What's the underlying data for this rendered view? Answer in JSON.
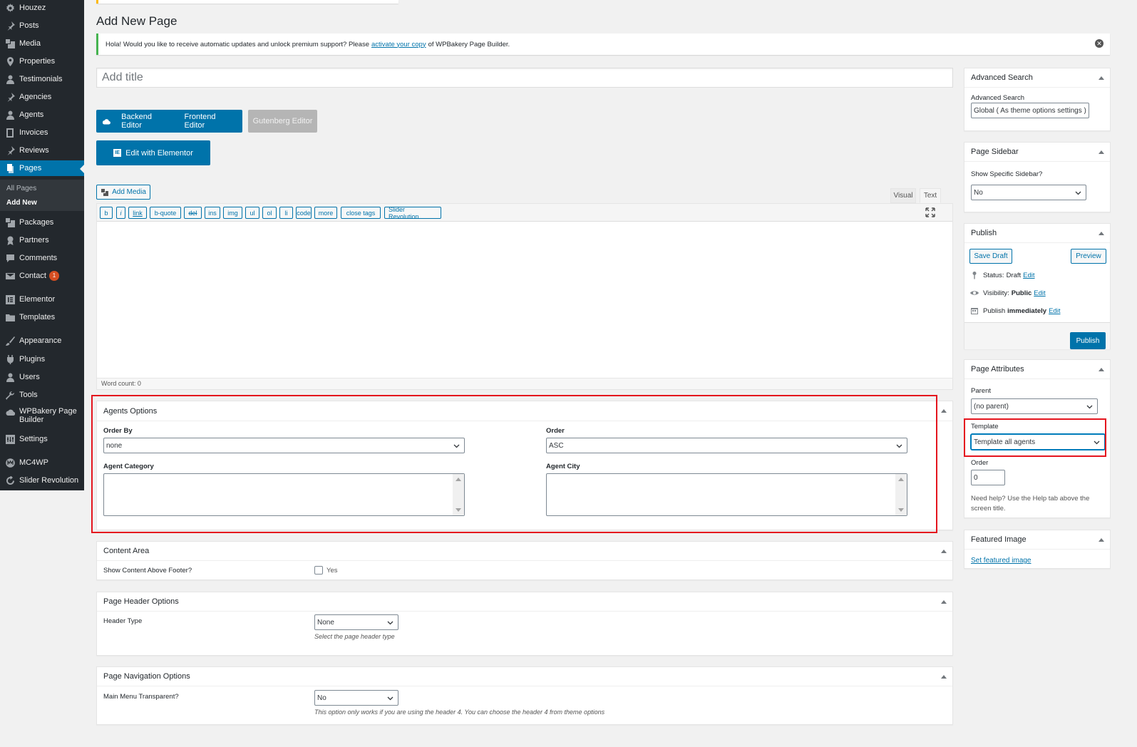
{
  "sidebar": {
    "items": [
      {
        "label": "Houzez",
        "icon": "gear-icon"
      },
      {
        "label": "Posts",
        "icon": "pin-icon"
      },
      {
        "label": "Media",
        "icon": "media-icon"
      },
      {
        "label": "Properties",
        "icon": "location-icon"
      },
      {
        "label": "Testimonials",
        "icon": "user-icon"
      },
      {
        "label": "Agencies",
        "icon": "pin-icon"
      },
      {
        "label": "Agents",
        "icon": "user-icon"
      },
      {
        "label": "Invoices",
        "icon": "book-icon"
      },
      {
        "label": "Reviews",
        "icon": "pin-icon"
      },
      {
        "label": "Pages",
        "icon": "pages-icon"
      },
      {
        "label": "Packages",
        "icon": "media-icon"
      },
      {
        "label": "Partners",
        "icon": "award-icon"
      },
      {
        "label": "Comments",
        "icon": "comment-icon"
      },
      {
        "label": "Contact",
        "icon": "mail-icon",
        "badge": "1"
      },
      {
        "label": "Elementor",
        "icon": "elementor-icon"
      },
      {
        "label": "Templates",
        "icon": "folder-icon"
      },
      {
        "label": "Appearance",
        "icon": "brush-icon"
      },
      {
        "label": "Plugins",
        "icon": "plugin-icon"
      },
      {
        "label": "Users",
        "icon": "user-icon"
      },
      {
        "label": "Tools",
        "icon": "wrench-icon"
      },
      {
        "label": "WPBakery Page Builder",
        "line1": "WPBakery Page",
        "line2": "Builder",
        "icon": "cloud-icon"
      },
      {
        "label": "Settings",
        "icon": "settings-icon"
      },
      {
        "label": "MC4WP",
        "icon": "mc4wp-icon"
      },
      {
        "label": "Slider Revolution",
        "icon": "refresh-icon"
      }
    ],
    "submenu": {
      "all_pages": "All Pages",
      "add_new": "Add New"
    }
  },
  "page": {
    "title": "Add New Page",
    "notice_text_before": "Hola! Would you like to receive automatic updates and unlock premium support? Please",
    "notice_link": "activate your copy",
    "notice_text_after": "of WPBakery Page Builder.",
    "title_placeholder": "Add title"
  },
  "editor_buttons": {
    "backend": "Backend Editor",
    "frontend": "Frontend Editor",
    "gutenberg": "Gutenberg Editor",
    "elementor": "Edit with Elementor",
    "elementor_icon_text": "IE"
  },
  "editor": {
    "add_media": "Add Media",
    "tab_visual": "Visual",
    "tab_text": "Text",
    "quicktags": [
      "b",
      "i",
      "link",
      "b-quote",
      "del",
      "ins",
      "img",
      "ul",
      "ol",
      "li",
      "code",
      "more",
      "close tags",
      "Slider Revolution"
    ],
    "word_count": "Word count: 0"
  },
  "agents_options": {
    "title": "Agents Options",
    "order_by_label": "Order By",
    "order_by_value": "none",
    "order_label": "Order",
    "order_value": "ASC",
    "category_label": "Agent Category",
    "city_label": "Agent City"
  },
  "content_area": {
    "title": "Content Area",
    "label": "Show Content Above Footer?",
    "checkbox_label": "Yes"
  },
  "page_header": {
    "title": "Page Header Options",
    "label": "Header Type",
    "value": "None",
    "help": "Select the page header type"
  },
  "page_nav": {
    "title": "Page Navigation Options",
    "label": "Main Menu Transparent?",
    "value": "No",
    "help": "This option only works if you are using the header 4. You can choose the header 4 from theme options"
  },
  "advanced_search": {
    "title": "Advanced Search",
    "label": "Advanced Search",
    "value": "Global ( As theme options settings )"
  },
  "page_sidebar": {
    "title": "Page Sidebar",
    "label": "Show Specific Sidebar?",
    "value": "No"
  },
  "publish": {
    "title": "Publish",
    "save_draft": "Save Draft",
    "preview": "Preview",
    "status_label": "Status:",
    "status_value": "Draft",
    "visibility_label": "Visibility:",
    "visibility_value": "Public",
    "schedule_label": "Publish",
    "schedule_value": "immediately",
    "edit": "Edit",
    "publish_button": "Publish"
  },
  "page_attributes": {
    "title": "Page Attributes",
    "parent_label": "Parent",
    "parent_value": "(no parent)",
    "template_label": "Template",
    "template_value": "Template all agents",
    "order_label": "Order",
    "order_value": "0",
    "help": "Need help? Use the Help tab above the screen title."
  },
  "featured_image": {
    "title": "Featured Image",
    "link": "Set featured image"
  },
  "colors": {
    "sidebar_bg": "#23282d",
    "accent": "#0073aa",
    "notice_border": "#46b450",
    "highlight": "#e4141e"
  }
}
